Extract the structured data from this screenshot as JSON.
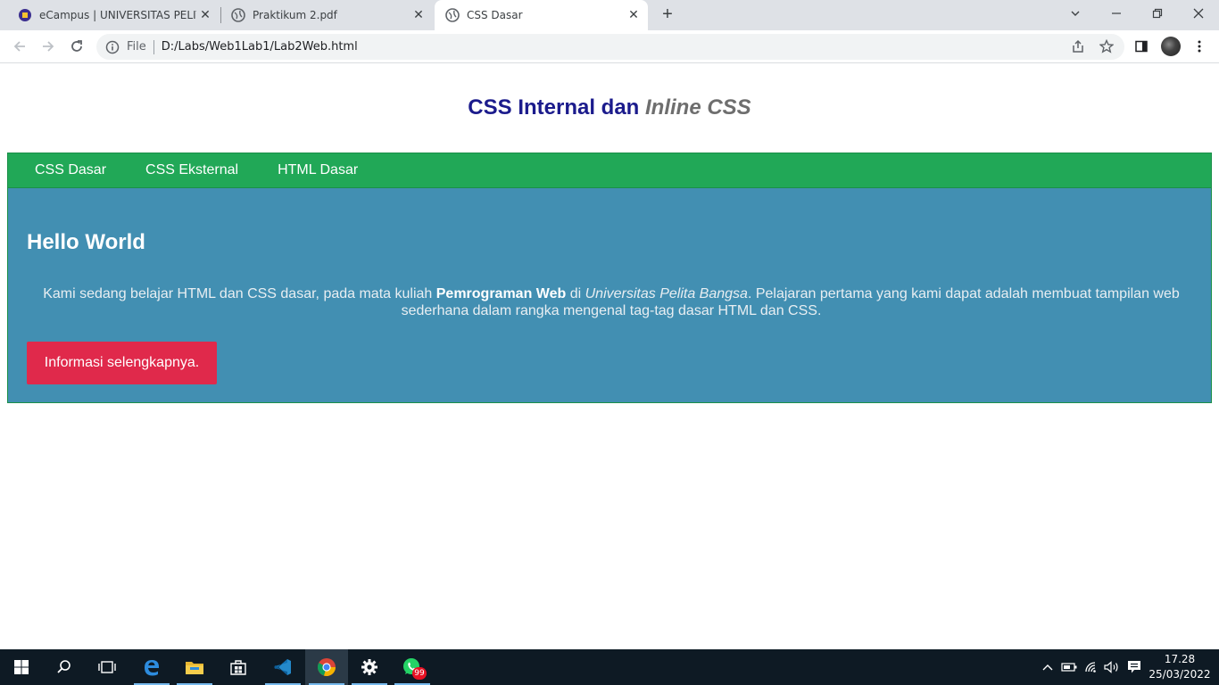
{
  "browser": {
    "tabs": [
      {
        "title": "eCampus | UNIVERSITAS PELITA BANGSA",
        "close": "✕"
      },
      {
        "title": "Praktikum 2.pdf",
        "close": "✕"
      },
      {
        "title": "CSS Dasar",
        "close": "✕"
      }
    ],
    "new_tab": "+",
    "address": {
      "scheme_label": "File",
      "url": "D:/Labs/Web1Lab1/Lab2Web.html"
    }
  },
  "page": {
    "header": {
      "title_plain": "CSS Internal dan ",
      "title_italic": "Inline CSS"
    },
    "nav": [
      "CSS Dasar",
      "CSS Eksternal",
      "HTML Dasar"
    ],
    "hero": {
      "heading": "Hello World",
      "text_1": "Kami sedang belajar HTML dan CSS dasar, pada mata kuliah ",
      "text_bold": "Pemrograman Web",
      "text_2": " di ",
      "text_italic": "Universitas Pelita Bangsa",
      "text_3": ". Pelajaran pertama yang kami dapat adalah membuat tampilan web sederhana dalam rangka mengenal tag-tag dasar HTML dan CSS.",
      "button": "Informasi selengkapnya."
    },
    "colors": {
      "header": "#1b1b8c",
      "nav": "#21a857",
      "hero": "#428fb2",
      "button": "#e0294b"
    }
  },
  "taskbar": {
    "clock_time": "17.28",
    "clock_date": "25/03/2022",
    "whatsapp_badge": "99"
  }
}
